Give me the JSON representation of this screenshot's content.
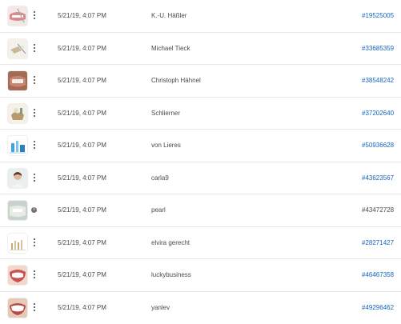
{
  "colors": {
    "link": "#1565c0",
    "text": "#4b4b4b",
    "divider": "#e6e6e6"
  },
  "rows": [
    {
      "thumb_icon": "dental-photo-icon",
      "date": "5/21/19, 4:07 PM",
      "user": "K.-U. Häßler",
      "id": "#19525005",
      "id_link": true,
      "menu": "more-vertical-icon"
    },
    {
      "thumb_icon": "dental-photo-icon",
      "date": "5/21/19, 4:07 PM",
      "user": "Michael Tieck",
      "id": "#33685359",
      "id_link": true,
      "menu": "more-vertical-icon"
    },
    {
      "thumb_icon": "dental-photo-icon",
      "date": "5/21/19, 4:07 PM",
      "user": "Christoph Hähnel",
      "id": "#38548242",
      "id_link": true,
      "menu": "more-vertical-icon"
    },
    {
      "thumb_icon": "dental-photo-icon",
      "date": "5/21/19, 4:07 PM",
      "user": "Schlierner",
      "id": "#37202640",
      "id_link": true,
      "menu": "more-vertical-icon"
    },
    {
      "thumb_icon": "dental-photo-icon",
      "date": "5/21/19, 4:07 PM",
      "user": "von Lieres",
      "id": "#50936628",
      "id_link": true,
      "menu": "more-vertical-icon"
    },
    {
      "thumb_icon": "dental-photo-icon",
      "date": "5/21/19, 4:07 PM",
      "user": "carla9",
      "id": "#43623567",
      "id_link": true,
      "menu": "more-vertical-icon"
    },
    {
      "thumb_icon": "dental-photo-icon",
      "date": "5/21/19, 4:07 PM",
      "user": "pearl",
      "id": "#43472728",
      "id_link": false,
      "menu": "info-icon"
    },
    {
      "thumb_icon": "dental-photo-icon",
      "date": "5/21/19, 4:07 PM",
      "user": "elvira gerecht",
      "id": "#28271427",
      "id_link": true,
      "menu": "more-vertical-icon"
    },
    {
      "thumb_icon": "dental-photo-icon",
      "date": "5/21/19, 4:07 PM",
      "user": "luckybusiness",
      "id": "#46467358",
      "id_link": true,
      "menu": "more-vertical-icon"
    },
    {
      "thumb_icon": "dental-photo-icon",
      "date": "5/21/19, 4:07 PM",
      "user": "yanlev",
      "id": "#49296462",
      "id_link": true,
      "menu": "more-vertical-icon"
    }
  ]
}
